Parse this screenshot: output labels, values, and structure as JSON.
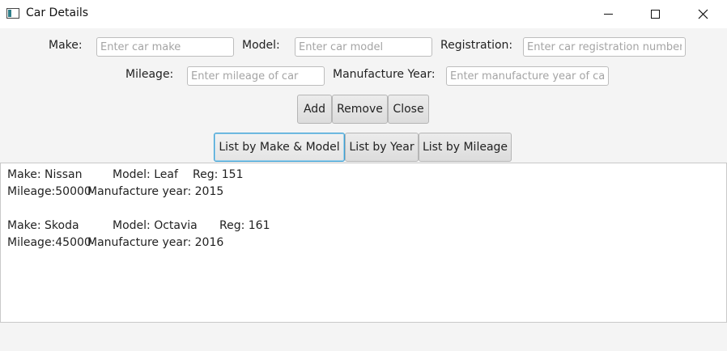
{
  "window": {
    "title": "Car Details"
  },
  "form": {
    "make_label": "Make:",
    "make_placeholder": "Enter car make",
    "model_label": "Model:",
    "model_placeholder": "Enter car model",
    "registration_label": "Registration:",
    "registration_placeholder": "Enter car registration number",
    "mileage_label": "Mileage:",
    "mileage_placeholder": "Enter mileage of car",
    "year_label": "Manufacture Year:",
    "year_placeholder": "Enter manufacture year of car"
  },
  "actions": {
    "add": "Add",
    "remove": "Remove",
    "close": "Close"
  },
  "list_buttons": {
    "by_make_model": "List by Make & Model",
    "by_year": "List by Year",
    "by_mileage": "List by Mileage"
  },
  "cars": [
    {
      "make": "Make: Nissan",
      "model": "Model: Leaf",
      "reg": "Reg: 151",
      "mileage": "Mileage:50000",
      "year": "Manufacture year: 2015"
    },
    {
      "make": "Make: Skoda",
      "model": "Model: Octavia",
      "reg": "Reg: 161",
      "mileage": "Mileage:45000",
      "year": "Manufacture year: 2016"
    }
  ]
}
